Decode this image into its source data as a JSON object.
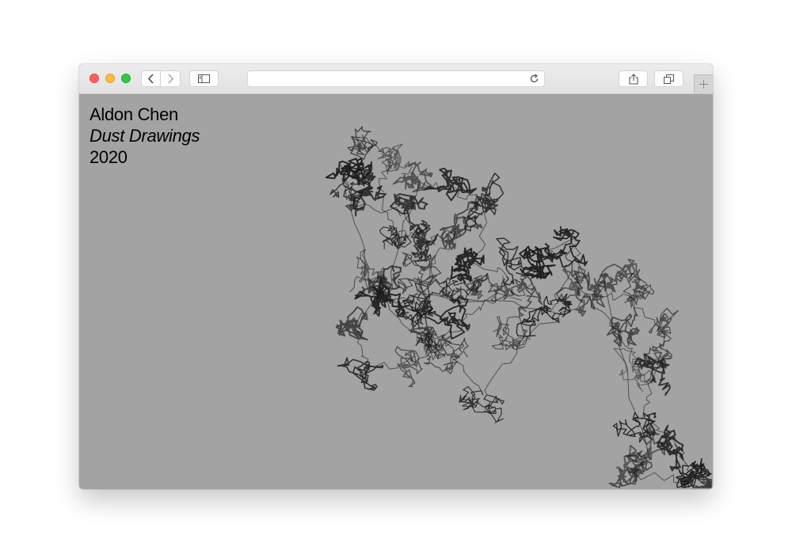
{
  "browser": {
    "window_controls": [
      "close",
      "minimize",
      "zoom"
    ],
    "toolbar_icons": {
      "back": "chevron-left-icon",
      "forward": "chevron-right-icon",
      "sidebar": "sidebar-icon",
      "reload": "reload-icon",
      "share": "share-icon",
      "tabs": "tabs-overview-icon",
      "new_tab": "plus-icon"
    },
    "address_value": ""
  },
  "page": {
    "background_color": "#a3a3a3",
    "author": "Aldon Chen",
    "title": "Dust Drawings",
    "year": "2020"
  },
  "artwork": {
    "type": "random-walk line drawing",
    "stroke_color": "#1a1a1a"
  }
}
